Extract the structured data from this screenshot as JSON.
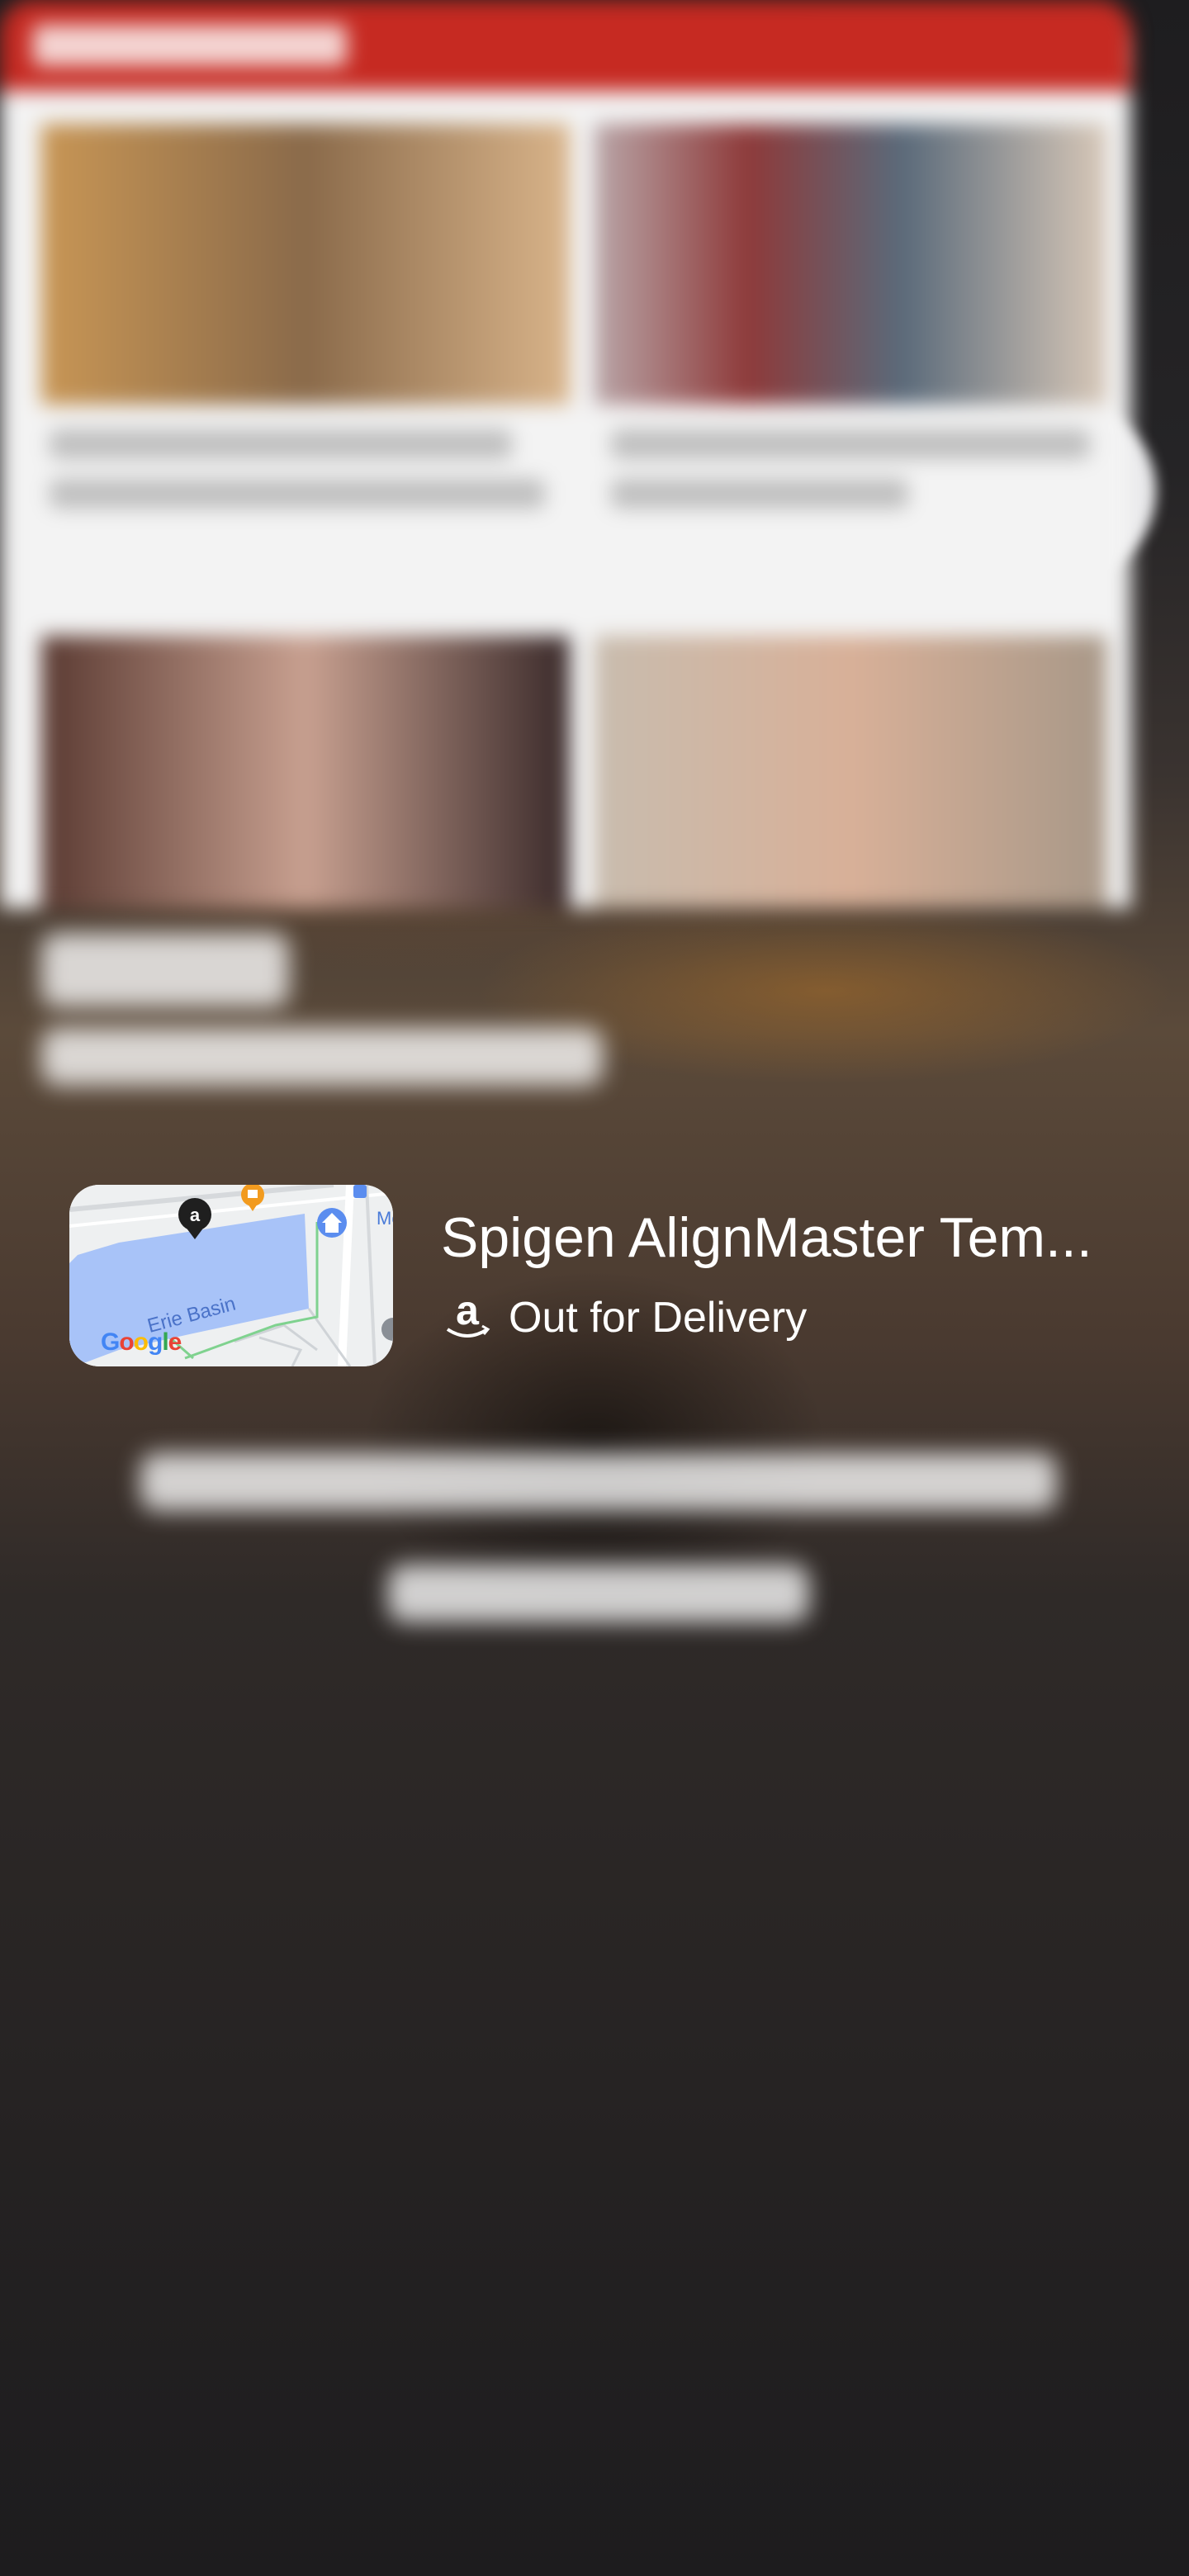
{
  "delivery": {
    "title": "Spigen AlignMaster Tem...",
    "status": "Out for Delivery",
    "store_icon": "amazon-icon",
    "map": {
      "label": "Erie Basin",
      "poi_label": "Mob",
      "watermark": "Google"
    }
  },
  "colors": {
    "google_blue": "#4285F4",
    "google_red": "#EA4335",
    "google_yellow": "#FBBC05",
    "google_green": "#34A853",
    "news_header_red": "#C62A22",
    "map_water": "#A8C3F8"
  }
}
